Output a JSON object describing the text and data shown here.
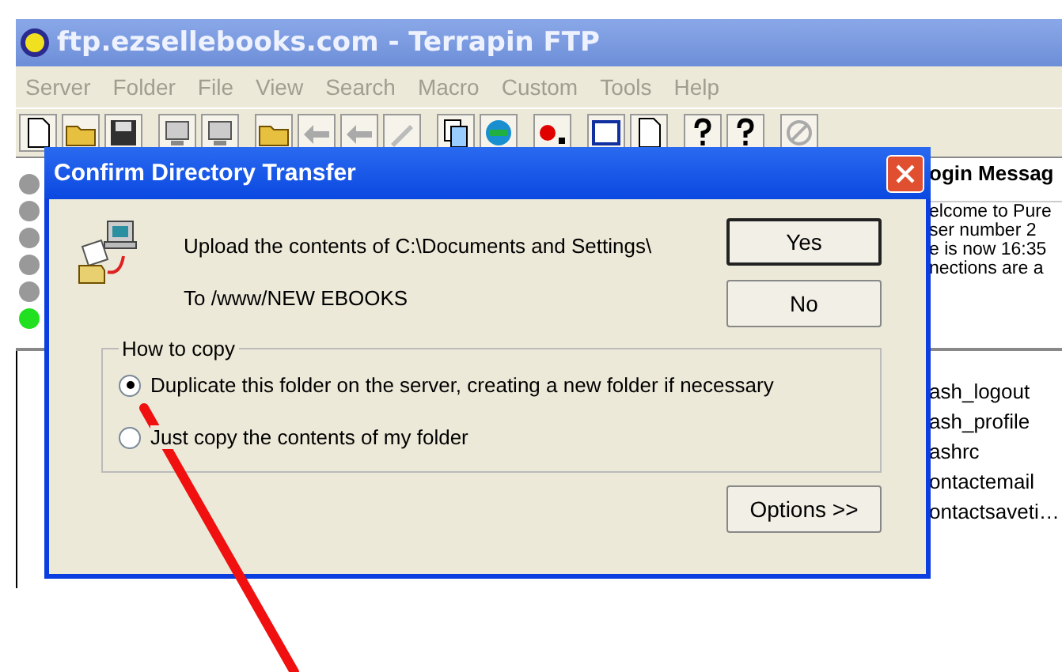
{
  "window": {
    "title": "ftp.ezsellebooks.com - Terrapin FTP"
  },
  "menu": [
    "Server",
    "Folder",
    "File",
    "View",
    "Search",
    "Macro",
    "Custom",
    "Tools",
    "Help"
  ],
  "status_lights": [
    {
      "on": false
    },
    {
      "on": false
    },
    {
      "on": false
    },
    {
      "on": false
    },
    {
      "on": false
    },
    {
      "on": true
    }
  ],
  "login_panel": {
    "title": "ogin Messag",
    "lines": [
      "elcome to Pure",
      "ser number 2",
      "e is now 16:35",
      "nections are a"
    ]
  },
  "remote_files": [
    "ash_logout",
    "ash_profile",
    "ashrc",
    "ontactemail",
    "ontactsaveti…"
  ],
  "dialog": {
    "title": "Confirm Directory Transfer",
    "message": "Upload the contents of C:\\Documents and Settings\\",
    "destination": "To /www/NEW EBOOKS",
    "buttons": [
      {
        "label": "Yes",
        "default": true
      },
      {
        "label": "No",
        "default": false
      }
    ],
    "group_label": "How to copy",
    "options": [
      {
        "label": "Duplicate this folder on the server, creating a new folder if necessary",
        "selected": true
      },
      {
        "label": "Just copy the contents of my folder",
        "selected": false
      }
    ],
    "options_button": "Options >>"
  }
}
